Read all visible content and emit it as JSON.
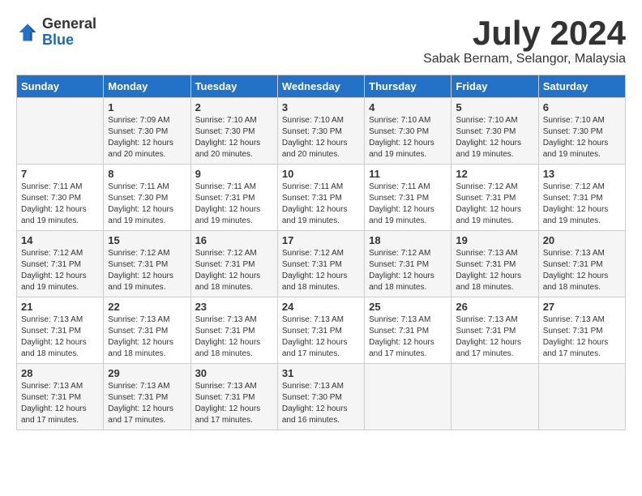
{
  "logo": {
    "general": "General",
    "blue": "Blue"
  },
  "title": {
    "month_year": "July 2024",
    "location": "Sabak Bernam, Selangor, Malaysia"
  },
  "days_of_week": [
    "Sunday",
    "Monday",
    "Tuesday",
    "Wednesday",
    "Thursday",
    "Friday",
    "Saturday"
  ],
  "weeks": [
    [
      {
        "day": "",
        "sunrise": "",
        "sunset": "",
        "daylight": ""
      },
      {
        "day": "1",
        "sunrise": "Sunrise: 7:09 AM",
        "sunset": "Sunset: 7:30 PM",
        "daylight": "Daylight: 12 hours and 20 minutes."
      },
      {
        "day": "2",
        "sunrise": "Sunrise: 7:10 AM",
        "sunset": "Sunset: 7:30 PM",
        "daylight": "Daylight: 12 hours and 20 minutes."
      },
      {
        "day": "3",
        "sunrise": "Sunrise: 7:10 AM",
        "sunset": "Sunset: 7:30 PM",
        "daylight": "Daylight: 12 hours and 20 minutes."
      },
      {
        "day": "4",
        "sunrise": "Sunrise: 7:10 AM",
        "sunset": "Sunset: 7:30 PM",
        "daylight": "Daylight: 12 hours and 19 minutes."
      },
      {
        "day": "5",
        "sunrise": "Sunrise: 7:10 AM",
        "sunset": "Sunset: 7:30 PM",
        "daylight": "Daylight: 12 hours and 19 minutes."
      },
      {
        "day": "6",
        "sunrise": "Sunrise: 7:10 AM",
        "sunset": "Sunset: 7:30 PM",
        "daylight": "Daylight: 12 hours and 19 minutes."
      }
    ],
    [
      {
        "day": "7",
        "sunrise": "Sunrise: 7:11 AM",
        "sunset": "Sunset: 7:30 PM",
        "daylight": "Daylight: 12 hours and 19 minutes."
      },
      {
        "day": "8",
        "sunrise": "Sunrise: 7:11 AM",
        "sunset": "Sunset: 7:30 PM",
        "daylight": "Daylight: 12 hours and 19 minutes."
      },
      {
        "day": "9",
        "sunrise": "Sunrise: 7:11 AM",
        "sunset": "Sunset: 7:31 PM",
        "daylight": "Daylight: 12 hours and 19 minutes."
      },
      {
        "day": "10",
        "sunrise": "Sunrise: 7:11 AM",
        "sunset": "Sunset: 7:31 PM",
        "daylight": "Daylight: 12 hours and 19 minutes."
      },
      {
        "day": "11",
        "sunrise": "Sunrise: 7:11 AM",
        "sunset": "Sunset: 7:31 PM",
        "daylight": "Daylight: 12 hours and 19 minutes."
      },
      {
        "day": "12",
        "sunrise": "Sunrise: 7:12 AM",
        "sunset": "Sunset: 7:31 PM",
        "daylight": "Daylight: 12 hours and 19 minutes."
      },
      {
        "day": "13",
        "sunrise": "Sunrise: 7:12 AM",
        "sunset": "Sunset: 7:31 PM",
        "daylight": "Daylight: 12 hours and 19 minutes."
      }
    ],
    [
      {
        "day": "14",
        "sunrise": "Sunrise: 7:12 AM",
        "sunset": "Sunset: 7:31 PM",
        "daylight": "Daylight: 12 hours and 19 minutes."
      },
      {
        "day": "15",
        "sunrise": "Sunrise: 7:12 AM",
        "sunset": "Sunset: 7:31 PM",
        "daylight": "Daylight: 12 hours and 19 minutes."
      },
      {
        "day": "16",
        "sunrise": "Sunrise: 7:12 AM",
        "sunset": "Sunset: 7:31 PM",
        "daylight": "Daylight: 12 hours and 18 minutes."
      },
      {
        "day": "17",
        "sunrise": "Sunrise: 7:12 AM",
        "sunset": "Sunset: 7:31 PM",
        "daylight": "Daylight: 12 hours and 18 minutes."
      },
      {
        "day": "18",
        "sunrise": "Sunrise: 7:12 AM",
        "sunset": "Sunset: 7:31 PM",
        "daylight": "Daylight: 12 hours and 18 minutes."
      },
      {
        "day": "19",
        "sunrise": "Sunrise: 7:13 AM",
        "sunset": "Sunset: 7:31 PM",
        "daylight": "Daylight: 12 hours and 18 minutes."
      },
      {
        "day": "20",
        "sunrise": "Sunrise: 7:13 AM",
        "sunset": "Sunset: 7:31 PM",
        "daylight": "Daylight: 12 hours and 18 minutes."
      }
    ],
    [
      {
        "day": "21",
        "sunrise": "Sunrise: 7:13 AM",
        "sunset": "Sunset: 7:31 PM",
        "daylight": "Daylight: 12 hours and 18 minutes."
      },
      {
        "day": "22",
        "sunrise": "Sunrise: 7:13 AM",
        "sunset": "Sunset: 7:31 PM",
        "daylight": "Daylight: 12 hours and 18 minutes."
      },
      {
        "day": "23",
        "sunrise": "Sunrise: 7:13 AM",
        "sunset": "Sunset: 7:31 PM",
        "daylight": "Daylight: 12 hours and 18 minutes."
      },
      {
        "day": "24",
        "sunrise": "Sunrise: 7:13 AM",
        "sunset": "Sunset: 7:31 PM",
        "daylight": "Daylight: 12 hours and 17 minutes."
      },
      {
        "day": "25",
        "sunrise": "Sunrise: 7:13 AM",
        "sunset": "Sunset: 7:31 PM",
        "daylight": "Daylight: 12 hours and 17 minutes."
      },
      {
        "day": "26",
        "sunrise": "Sunrise: 7:13 AM",
        "sunset": "Sunset: 7:31 PM",
        "daylight": "Daylight: 12 hours and 17 minutes."
      },
      {
        "day": "27",
        "sunrise": "Sunrise: 7:13 AM",
        "sunset": "Sunset: 7:31 PM",
        "daylight": "Daylight: 12 hours and 17 minutes."
      }
    ],
    [
      {
        "day": "28",
        "sunrise": "Sunrise: 7:13 AM",
        "sunset": "Sunset: 7:31 PM",
        "daylight": "Daylight: 12 hours and 17 minutes."
      },
      {
        "day": "29",
        "sunrise": "Sunrise: 7:13 AM",
        "sunset": "Sunset: 7:31 PM",
        "daylight": "Daylight: 12 hours and 17 minutes."
      },
      {
        "day": "30",
        "sunrise": "Sunrise: 7:13 AM",
        "sunset": "Sunset: 7:31 PM",
        "daylight": "Daylight: 12 hours and 17 minutes."
      },
      {
        "day": "31",
        "sunrise": "Sunrise: 7:13 AM",
        "sunset": "Sunset: 7:30 PM",
        "daylight": "Daylight: 12 hours and 16 minutes."
      },
      {
        "day": "",
        "sunrise": "",
        "sunset": "",
        "daylight": ""
      },
      {
        "day": "",
        "sunrise": "",
        "sunset": "",
        "daylight": ""
      },
      {
        "day": "",
        "sunrise": "",
        "sunset": "",
        "daylight": ""
      }
    ]
  ]
}
